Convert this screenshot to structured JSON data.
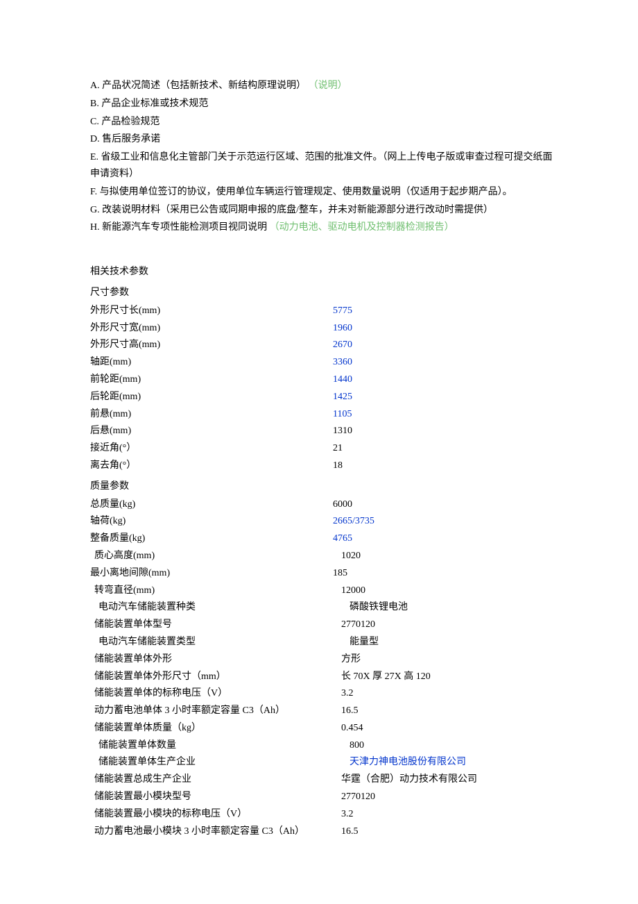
{
  "list": {
    "a_prefix": "A. 产品状况简述（包括新技术、新结构原理说明）",
    "a_green": "（说明）",
    "b": "B. 产品企业标准或技术规范",
    "c": "C. 产品检验规范",
    "d": "D. 售后服务承诺",
    "e": "E. 省级工业和信息化主管部门关于示范运行区域、范围的批准文件。（网上上传电子版或审查过程可提交纸面申请资料）",
    "f": "F. 与拟使用单位签订的协议，使用单位车辆运行管理规定、使用数量说明（仅适用于起步期产品）。",
    "g": "G. 改装说明材料（采用已公告或同期申报的底盘/整车，并未对新能源部分进行改动时需提供）",
    "h_prefix": "H. 新能源汽车专项性能检测项目视同说明",
    "h_green": "（动力电池、驱动电机及控制器检测报告）"
  },
  "headers": {
    "related_tech": "相关技术参数",
    "size_params": "尺寸参数",
    "mass_params": "质量参数"
  },
  "params": {
    "size": [
      {
        "label": "外形尺寸长(mm)",
        "value": "5775",
        "blue": true
      },
      {
        "label": "外形尺寸宽(mm)",
        "value": "1960",
        "blue": true
      },
      {
        "label": "外形尺寸高(mm)",
        "value": "2670",
        "blue": true
      },
      {
        "label": "轴距(mm)",
        "value": "3360",
        "blue": true
      },
      {
        "label": "前轮距(mm)",
        "value": "1440",
        "blue": true
      },
      {
        "label": "后轮距(mm)",
        "value": "1425",
        "blue": true
      },
      {
        "label": "前悬(mm)",
        "value": "1105",
        "blue": true
      },
      {
        "label": "后悬(mm)",
        "value": "1310",
        "blue": false
      },
      {
        "label": "接近角(°）",
        "value": "21",
        "blue": false
      },
      {
        "label": "离去角(°）",
        "value": "18",
        "blue": false
      }
    ],
    "mass": [
      {
        "label": "总质量(kg)",
        "value": "6000",
        "blue": false,
        "indent": 0
      },
      {
        "label": "轴荷(kg)",
        "value": "2665/3735",
        "blue": true,
        "indent": 0
      },
      {
        "label": "整备质量(kg)",
        "value": "4765",
        "blue": true,
        "indent": 0
      },
      {
        "label": "质心高度(mm)",
        "value": "1020",
        "blue": false,
        "indent": 1
      },
      {
        "label": "最小离地间隙(mm)",
        "value": "185",
        "blue": false,
        "indent": 0
      },
      {
        "label": "转弯直径(mm)",
        "value": "12000",
        "blue": false,
        "indent": 1
      },
      {
        "label": "电动汽车储能装置种类",
        "value": "磷酸铁锂电池",
        "blue": false,
        "indent": 2
      },
      {
        "label": "储能装置单体型号",
        "value": "2770120",
        "blue": false,
        "indent": 1
      },
      {
        "label": "电动汽车储能装置类型",
        "value": "能量型",
        "blue": false,
        "indent": 2
      },
      {
        "label": "储能装置单体外形",
        "value": "方形",
        "blue": false,
        "indent": 1
      },
      {
        "label": "储能装置单体外形尺寸（mm）",
        "value": "长 70X 厚 27X 高 120",
        "blue": false,
        "indent": 1
      },
      {
        "label": "储能装置单体的标称电压（V）",
        "value": "3.2",
        "blue": false,
        "indent": 1
      },
      {
        "label": "动力蓄电池单体 3 小时率额定容量 C3（Ah）",
        "value": "16.5",
        "blue": false,
        "indent": 1
      },
      {
        "label": "储能装置单体质量（kg）",
        "value": "0.454",
        "blue": false,
        "indent": 1
      },
      {
        "label": "储能装置单体数量",
        "value": "800",
        "blue": false,
        "indent": 2
      },
      {
        "label": "储能装置单体生产企业",
        "value": "天津力神电池股份有限公司",
        "blue": true,
        "indent": 2
      },
      {
        "label": "储能装置总成生产企业",
        "value": "华霆（合肥）动力技术有限公司",
        "blue": false,
        "indent": 1
      },
      {
        "label": "储能装置最小模块型号",
        "value": "2770120",
        "blue": false,
        "indent": 1
      },
      {
        "label": "储能装置最小模块的标称电压（V）",
        "value": "3.2",
        "blue": false,
        "indent": 1
      },
      {
        "label": "动力蓄电池最小模块 3 小时率额定容量 C3（Ah）",
        "value": "16.5",
        "blue": false,
        "indent": 1
      }
    ]
  }
}
